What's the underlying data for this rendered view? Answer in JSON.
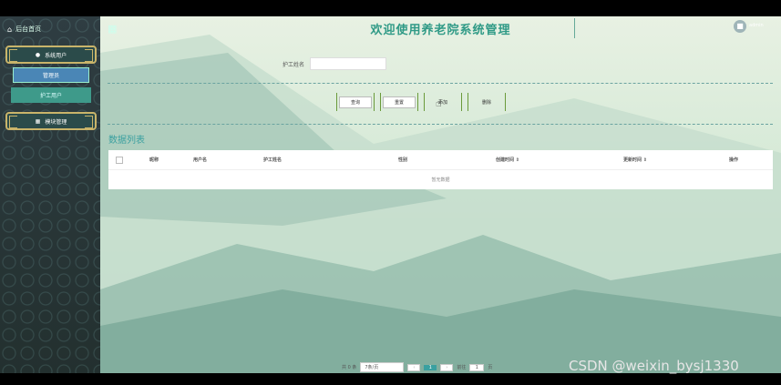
{
  "sidebar": {
    "home_label": "后台首页",
    "menus": [
      {
        "label": "系统用户"
      },
      {
        "label": "模块管理"
      }
    ],
    "sub_items": [
      "管理员",
      "护工用户"
    ]
  },
  "header": {
    "title": "欢迎使用养老院系统管理",
    "user_label": "admin"
  },
  "search": {
    "label": "护工姓名",
    "placeholder": "",
    "value": ""
  },
  "buttons": [
    "查询",
    "重置",
    "添加",
    "删除"
  ],
  "section_title": "数据列表",
  "table": {
    "columns": [
      "昵称",
      "用户名",
      "护工姓名",
      "性别",
      "创建时间 ⇕",
      "更新时间 ⇕",
      "操作"
    ],
    "empty_text": "暂无数据"
  },
  "pagination": {
    "total": "共 0 条",
    "page_size": "7条/页",
    "current_page": "1",
    "goto_label": "前往",
    "goto_value": "1",
    "page_suffix": "页"
  },
  "watermark": "CSDN @weixin_bysj1330",
  "colors": {
    "accent": "#3aa0a0",
    "title": "#2f9a86",
    "sidebar": "#2b3a3d"
  }
}
